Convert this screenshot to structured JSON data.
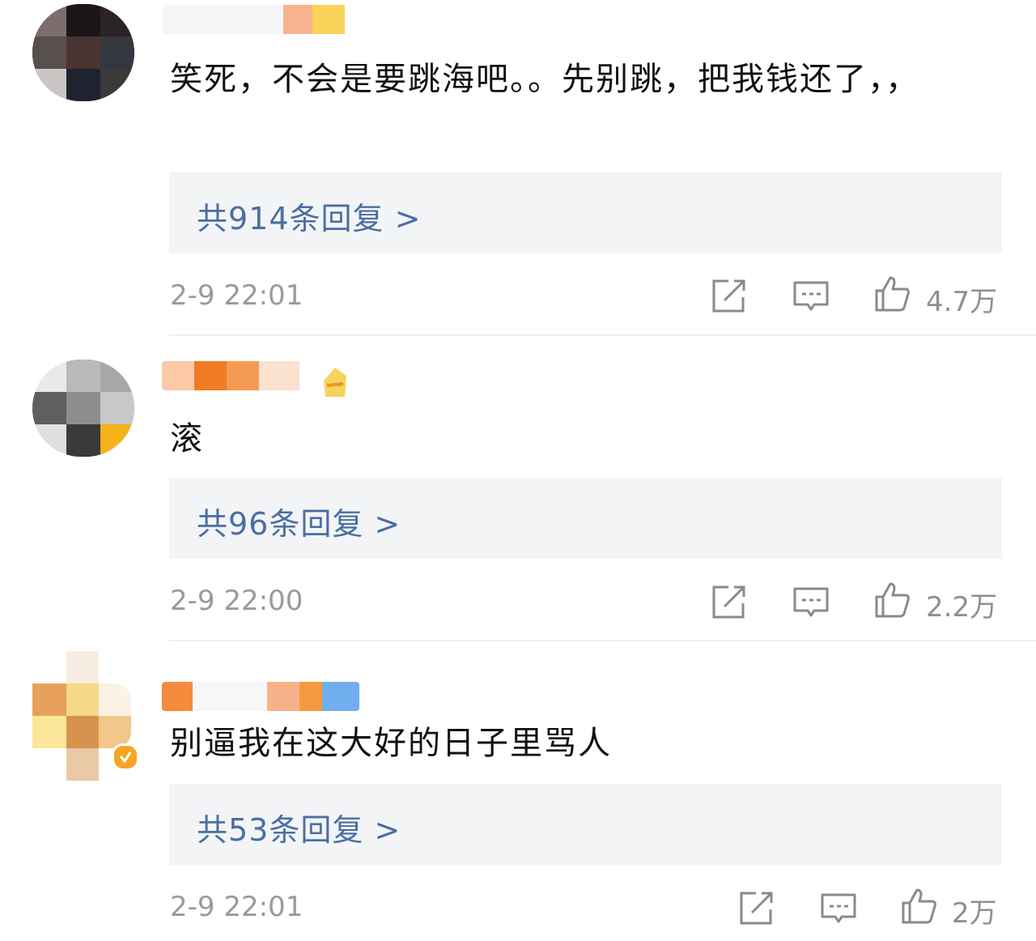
{
  "comments": [
    {
      "text": "笑死，不会是要跳海吧。。先别跳，把我钱还了，，",
      "replies": "共914条回复 >",
      "time": "2-9 22:01",
      "likes": "4.7万"
    },
    {
      "text": "滚",
      "replies": "共96条回复 >",
      "time": "2-9 22:00",
      "likes": "2.2万"
    },
    {
      "text": "别逼我在这大好的日子里骂人",
      "replies": "共53条回复 >",
      "time": "2-9 22:01",
      "likes": "2万"
    }
  ],
  "icons": {
    "repost": "share-icon",
    "comment": "comment-icon",
    "like": "thumbs-up-icon"
  },
  "colors": {
    "reply_link": "#4a6fa3",
    "reply_bg": "#f3f4f6",
    "meta_text": "#9a9a9a",
    "verified_badge": "#f5a623"
  }
}
